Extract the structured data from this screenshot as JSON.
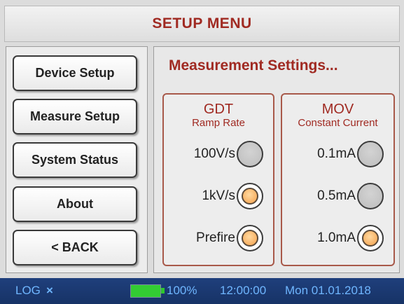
{
  "header": {
    "title": "SETUP MENU"
  },
  "menu": {
    "items": [
      {
        "label": "Device Setup"
      },
      {
        "label": "Measure Setup"
      },
      {
        "label": "System Status"
      },
      {
        "label": "About"
      },
      {
        "label": "< BACK"
      }
    ]
  },
  "main": {
    "section_title": "Measurement Settings...",
    "gdt": {
      "heading": "GDT",
      "subheading": "Ramp Rate",
      "options": [
        {
          "label": "100V/s",
          "selected": false
        },
        {
          "label": "1kV/s",
          "selected": true
        },
        {
          "label": "Prefire",
          "selected": true
        }
      ]
    },
    "mov": {
      "heading": "MOV",
      "subheading": "Constant Current",
      "options": [
        {
          "label": "0.1mA",
          "selected": false
        },
        {
          "label": "0.5mA",
          "selected": false
        },
        {
          "label": "1.0mA",
          "selected": true
        }
      ]
    }
  },
  "status_bar": {
    "log_label": "LOG",
    "close_glyph": "×",
    "battery_percent": "100%",
    "battery_level": 1.0,
    "time": "12:00:00",
    "date": "Mon 01.01.2018"
  },
  "colors": {
    "accent": "#a02a22",
    "status_bg": "#1f3f7c",
    "status_text": "#6fb6ff",
    "radio_on": "#f5a04a",
    "battery": "#33cc33"
  }
}
